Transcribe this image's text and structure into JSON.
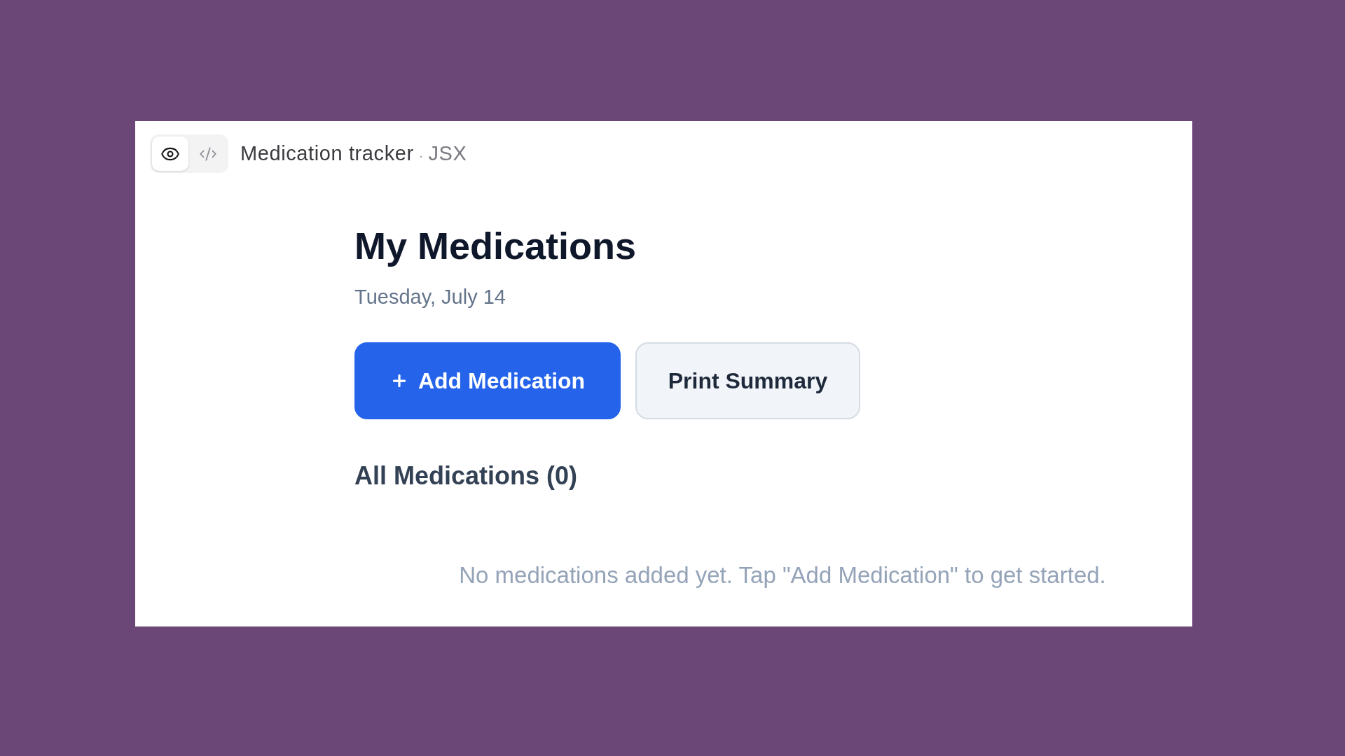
{
  "header": {
    "view_toggle": [
      {
        "kind": "preview",
        "selected": true
      },
      {
        "kind": "code",
        "selected": false
      }
    ],
    "title": "Medication tracker",
    "separator": "·",
    "file_type": "JSX"
  },
  "page": {
    "heading": "My Medications",
    "date": "Tuesday, July 14"
  },
  "actions": [
    {
      "kind": "primary",
      "label": "Add Medication"
    },
    {
      "kind": "secondary",
      "label": "Print Summary"
    }
  ],
  "section": {
    "title": "All Medications (0)",
    "empty_message": "No medications added yet. Tap \"Add Medication\" to get started."
  }
}
